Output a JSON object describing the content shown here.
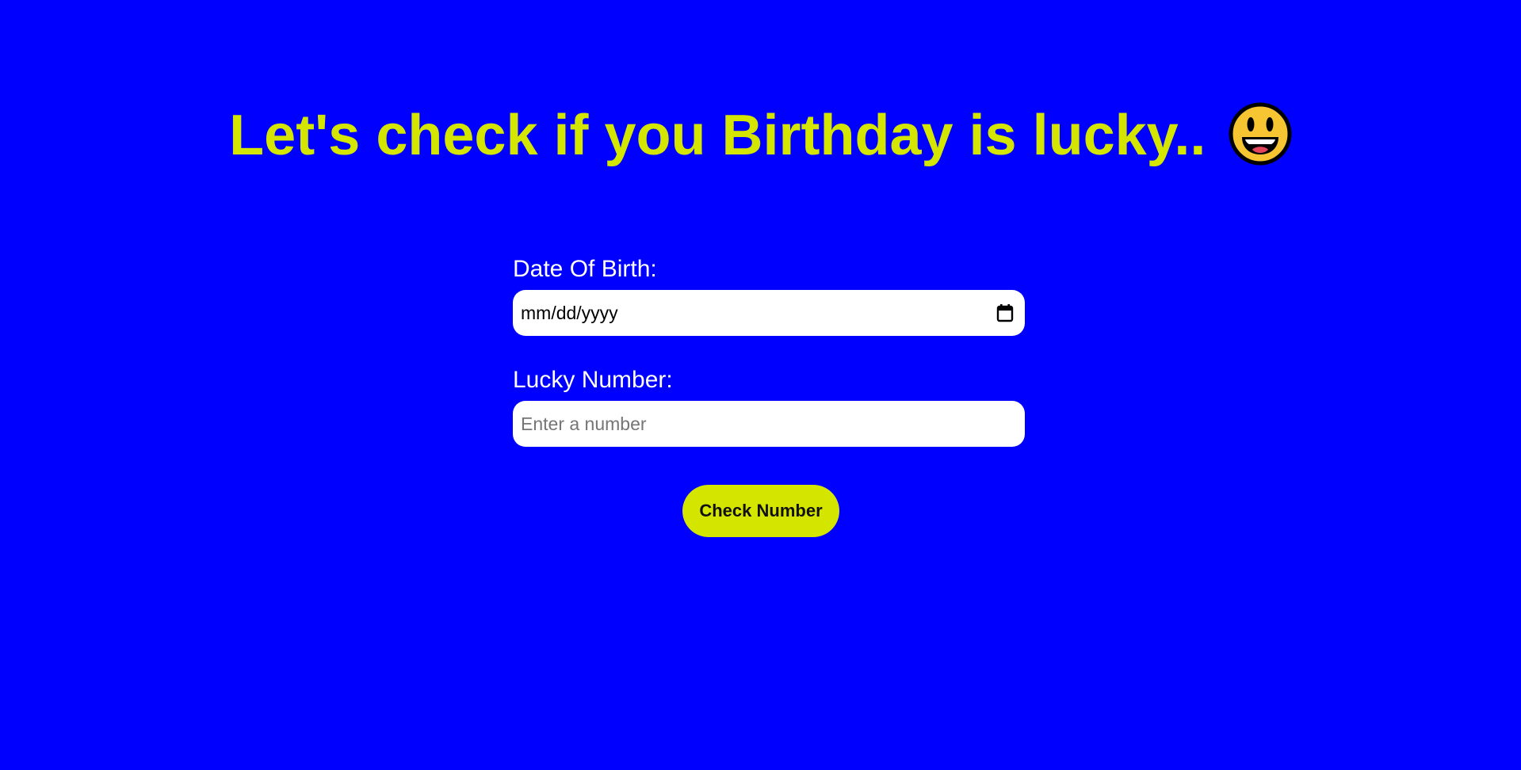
{
  "header": {
    "title": "Let's check if you Birthday is lucky..",
    "emoji_icon": "grinning-face-icon"
  },
  "form": {
    "dob": {
      "label": "Date Of Birth:",
      "value": "mm/dd/yyyy",
      "icon": "calendar-icon"
    },
    "lucky_number": {
      "label": "Lucky Number:",
      "placeholder": "Enter a number"
    },
    "submit_label": "Check Number"
  },
  "colors": {
    "background": "#0000ff",
    "accent": "#d4e600",
    "label_text": "#ffffff",
    "input_background": "#ffffff"
  }
}
